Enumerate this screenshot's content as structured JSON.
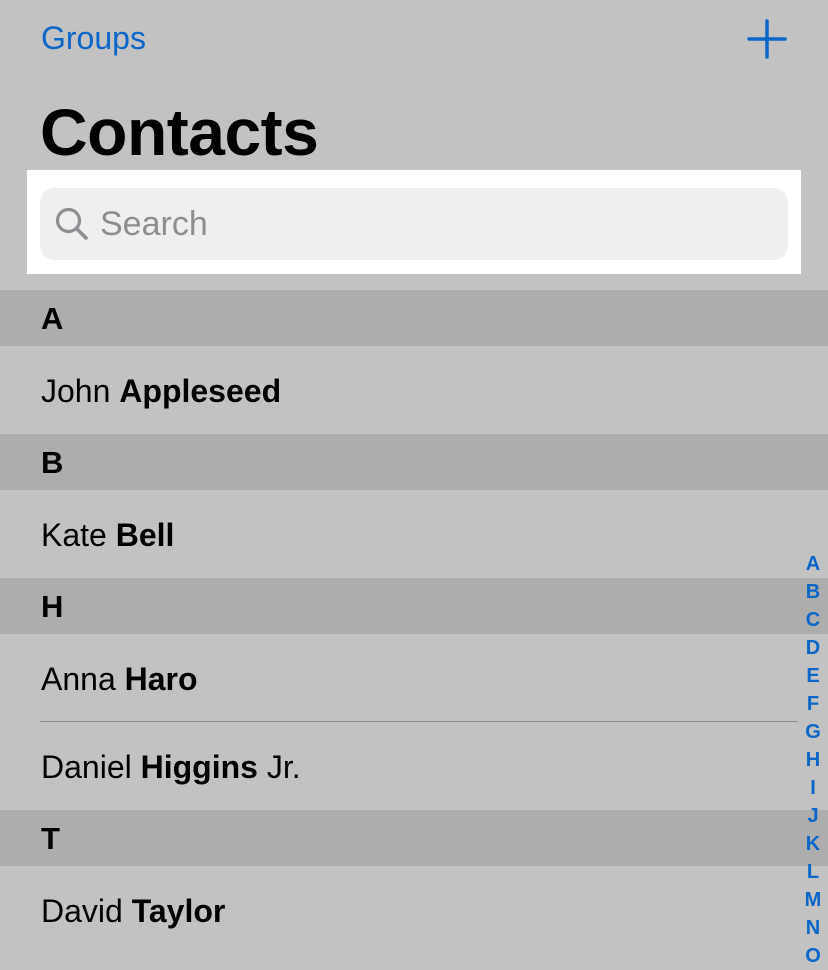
{
  "nav": {
    "groups_label": "Groups",
    "add_icon": "plus-icon"
  },
  "title": "Contacts",
  "search": {
    "placeholder": "Search",
    "icon": "magnifying-glass-icon"
  },
  "sections": [
    {
      "letter": "A",
      "contacts": [
        {
          "first": "John",
          "last": "Appleseed",
          "suffix": ""
        }
      ]
    },
    {
      "letter": "B",
      "contacts": [
        {
          "first": "Kate",
          "last": "Bell",
          "suffix": ""
        }
      ]
    },
    {
      "letter": "H",
      "contacts": [
        {
          "first": "Anna",
          "last": "Haro",
          "suffix": ""
        },
        {
          "first": "Daniel",
          "last": "Higgins",
          "suffix": "Jr."
        }
      ]
    },
    {
      "letter": "T",
      "contacts": [
        {
          "first": "David",
          "last": "Taylor",
          "suffix": ""
        }
      ]
    }
  ],
  "index_letters": [
    "A",
    "B",
    "C",
    "D",
    "E",
    "F",
    "G",
    "H",
    "I",
    "J",
    "K",
    "L",
    "M",
    "N",
    "O"
  ],
  "colors": {
    "accent": "#0a66c8",
    "background": "#c2c2c2",
    "section_header": "#adadad",
    "search_field": "#efefef"
  }
}
